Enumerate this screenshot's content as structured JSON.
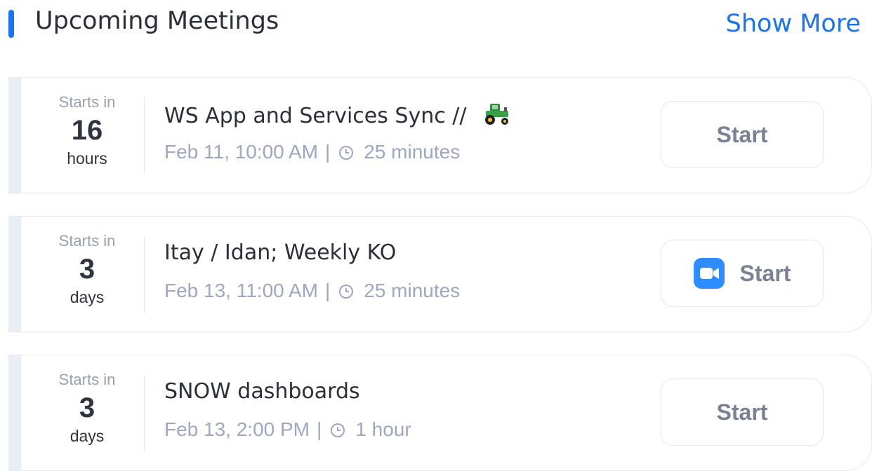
{
  "header": {
    "title": "Upcoming Meetings",
    "show_more": "Show More",
    "accent_color": "#1a73f5"
  },
  "meetings": [
    {
      "starts_in_label": "Starts in",
      "starts_in_value": "16",
      "starts_in_unit": "hours",
      "title": "WS App and Services Sync //",
      "title_emoji": "tractor-icon",
      "date": "Feb 11, 10:00 AM",
      "separator": "|",
      "duration": "25 minutes",
      "button_label": "Start",
      "button_icon": null
    },
    {
      "starts_in_label": "Starts in",
      "starts_in_value": "3",
      "starts_in_unit": "days",
      "title": "Itay / Idan; Weekly KO",
      "date": "Feb 13, 11:00 AM",
      "separator": "|",
      "duration": "25 minutes",
      "button_label": "Start",
      "button_icon": "zoom-icon"
    },
    {
      "starts_in_label": "Starts in",
      "starts_in_value": "3",
      "starts_in_unit": "days",
      "title": "SNOW dashboards",
      "date": "Feb 13, 2:00 PM",
      "separator": "|",
      "duration": "1 hour",
      "button_label": "Start",
      "button_icon": null
    }
  ]
}
